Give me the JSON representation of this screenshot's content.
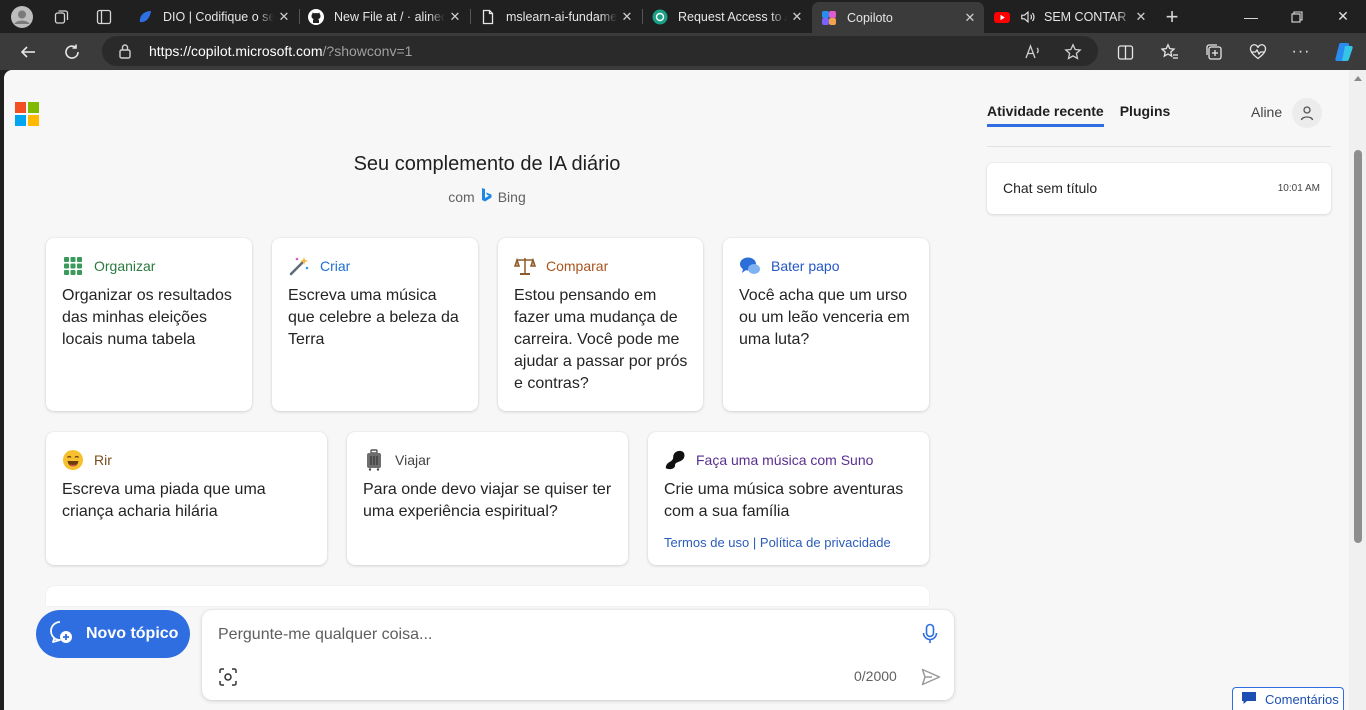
{
  "browser": {
    "tabs": [
      {
        "title": "DIO | Codifique o seu futuro",
        "icon": "dio-icon",
        "color": "#2f6fe4"
      },
      {
        "title": "New File at / · alinecastro",
        "icon": "github-icon",
        "color": "#ffffff"
      },
      {
        "title": "mslearn-ai-fundamentals",
        "icon": "document-icon",
        "color": "#e6e6e6"
      },
      {
        "title": "Request Access to Azure OpenAI",
        "icon": "openai-icon",
        "color": "#1aa086"
      },
      {
        "title": "Copiloto",
        "icon": "copilot-icon",
        "color": "#7b61ff"
      },
      {
        "title": "SEM CONTAR HISTÓRIAS",
        "icon": "youtube-icon",
        "color": "#ff0000"
      }
    ],
    "active_tab": "Copiloto",
    "url_host": "https://copilot.microsoft.com",
    "url_path": "/?showconv=1"
  },
  "page": {
    "headline": "Seu complemento de IA diário",
    "subline_prefix": "com",
    "subline_brand": "Bing",
    "cards_row1": [
      {
        "category": "Organizar",
        "category_color": "#2b7a3f",
        "icon": "grid-icon",
        "text": "Organizar os resultados das minhas eleições locais numa tabela"
      },
      {
        "category": "Criar",
        "category_color": "#1d6fd6",
        "icon": "magic-wand-icon",
        "text": "Escreva uma música que celebre a beleza da Terra"
      },
      {
        "category": "Comparar",
        "category_color": "#a8551f",
        "icon": "balance-scale-icon",
        "text": "Estou pensando em fazer uma mudança de carreira. Você pode me ajudar a passar por prós e contras?"
      },
      {
        "category": "Bater papo",
        "category_color": "#2357c6",
        "icon": "chat-bubbles-icon",
        "text": "Você acha que um urso ou um leão venceria em uma luta?"
      }
    ],
    "cards_row2": [
      {
        "category": "Rir",
        "category_color": "#7a4e1e",
        "icon": "laughing-face-icon",
        "text": "Escreva uma piada que uma criança acharia hilária"
      },
      {
        "category": "Viajar",
        "category_color": "#444444",
        "icon": "luggage-icon",
        "text": "Para onde devo viajar se quiser ter uma experiência espiritual?"
      },
      {
        "category": "Faça uma música com Suno",
        "category_color": "#5a2f91",
        "icon": "suno-icon",
        "text": "Crie uma música sobre aventuras com a sua família",
        "link_terms": "Termos de uso",
        "link_sep": "|",
        "link_privacy": "Política de privacidade"
      }
    ],
    "new_topic_label": "Novo tópico",
    "input_placeholder": "Pergunte-me qualquer coisa...",
    "input_value": "",
    "char_counter": "0/2000"
  },
  "right_panel": {
    "tab_recent": "Atividade recente",
    "tab_plugins": "Plugins",
    "user_name": "Aline",
    "chats": [
      {
        "title": "Chat sem título",
        "time": "10:01 AM"
      }
    ],
    "feedback_label": "Comentários"
  },
  "colors": {
    "accent": "#2f6ee0",
    "page_bg": "#f7f7f7",
    "chrome_bg": "#202020"
  }
}
